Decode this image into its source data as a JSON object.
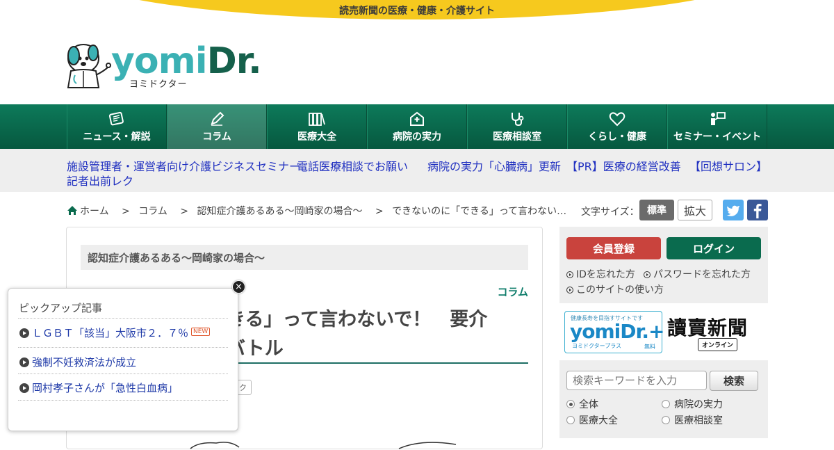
{
  "banner": {
    "tagline": "読売新聞の医療・健康・介護サイト"
  },
  "logo": {
    "word_y": "yomi",
    "word_d": "Dr.",
    "kana": "ヨミドクター"
  },
  "nav": {
    "items": [
      {
        "label": "ニュース・解説",
        "icon": "newspaper-icon"
      },
      {
        "label": "コラム",
        "icon": "pencil-icon"
      },
      {
        "label": "医療大全",
        "icon": "books-icon"
      },
      {
        "label": "病院の実力",
        "icon": "hospital-icon"
      },
      {
        "label": "医療相談室",
        "icon": "stethoscope-icon"
      },
      {
        "label": "くらし・健康",
        "icon": "heart-icon"
      },
      {
        "label": "セミナー・イベント",
        "icon": "presenter-icon"
      }
    ],
    "active_index": 1
  },
  "quick_links": [
    "施設管理者・運営者向け介護ビジネスセミナー",
    "電話医療相談でお願い",
    "病院の実力「心臓病」更新",
    "【PR】医療の経営改善",
    "【回想サロン】",
    "記者出前レク"
  ],
  "breadcrumb": {
    "home": "ホーム",
    "sep": ">",
    "items": [
      "コラム",
      "認知症介護あるある～岡崎家の場合～",
      "できないのに「できる」って言わない…"
    ]
  },
  "font_size": {
    "label": "文字サイズ：",
    "standard": "標準",
    "large": "拡大"
  },
  "article": {
    "series": "認知症介護あるある～岡崎家の場合～",
    "category": "コラム",
    "title_line1": "きる」って言わないで！　要介",
    "title_line2": "バトル",
    "tag": "ック"
  },
  "account": {
    "register": "会員登録",
    "login": "ログイン",
    "forgot_id": "IDを忘れた方",
    "forgot_password": "パスワードを忘れた方",
    "how_to_use": "このサイトの使い方"
  },
  "plus_banner": {
    "small": "健康長寿を目指すサイトです",
    "word": "yomiDr.+",
    "kana": "ヨミドクタープラス",
    "free": "無料"
  },
  "yomiuri": {
    "name": "讀賣新聞",
    "online": "オンライン"
  },
  "search": {
    "placeholder": "検索キーワードを入力",
    "button": "検索",
    "scopes": [
      "全体",
      "病院の実力",
      "医療大全",
      "医療相談室"
    ],
    "selected": "全体"
  },
  "pickup": {
    "title": "ピックアップ記事",
    "items": [
      {
        "text": "ＬＧＢＴ「該当」大阪市２．７％",
        "badge": "NEW"
      },
      {
        "text": "強制不妊救済法が成立"
      },
      {
        "text": "岡村孝子さんが「急性白血病」"
      }
    ],
    "close": "×"
  },
  "colors": {
    "nav_green": "#0a6b4e",
    "banner_yellow": "#f6c91e",
    "link_blue": "#1f2fc0",
    "register_red": "#c9433d"
  }
}
